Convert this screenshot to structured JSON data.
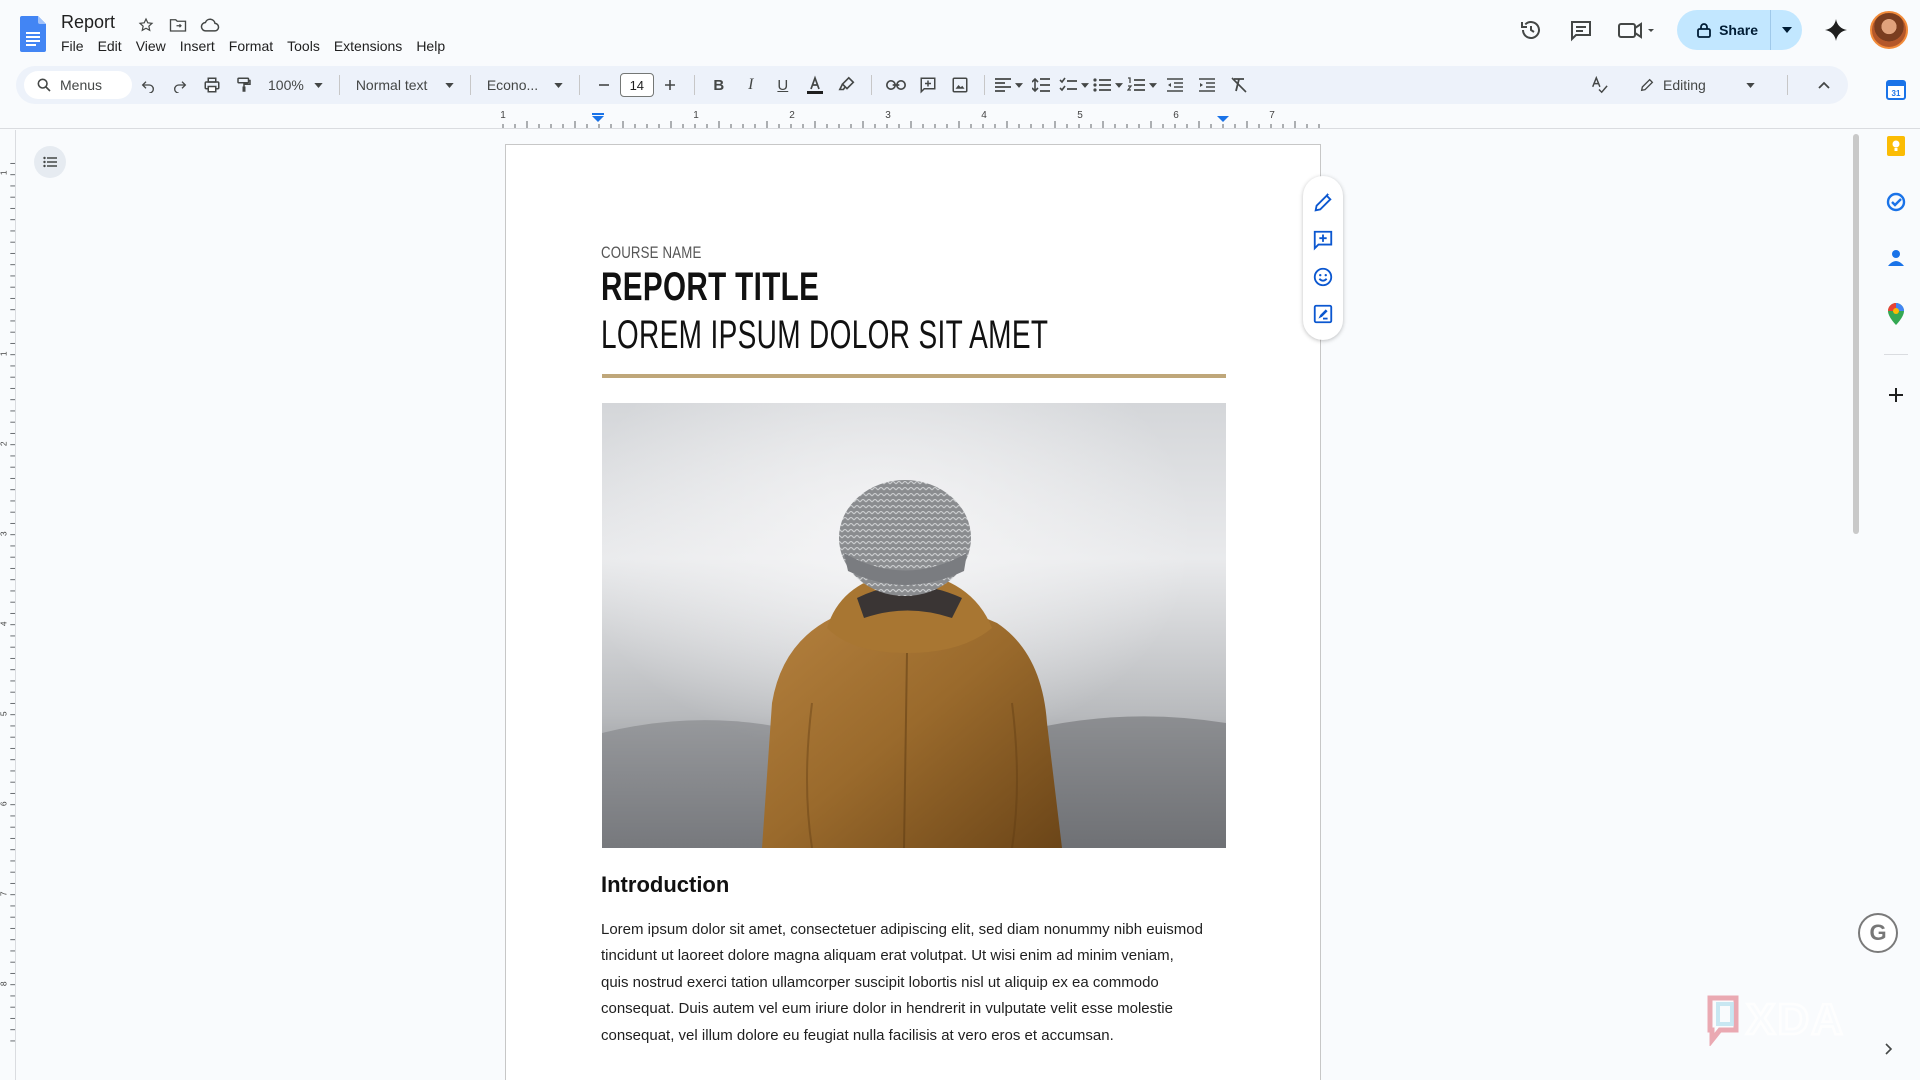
{
  "document": {
    "title": "Report",
    "menus": [
      "File",
      "Edit",
      "View",
      "Insert",
      "Format",
      "Tools",
      "Extensions",
      "Help"
    ]
  },
  "header": {
    "share_label": "Share"
  },
  "toolbar": {
    "menus_label": "Menus",
    "zoom": "100%",
    "style": "Normal text",
    "font": "Econo...",
    "font_size": "14",
    "mode": "Editing"
  },
  "ruler": {
    "labels": [
      "1",
      "1",
      "2",
      "3",
      "4",
      "5",
      "6",
      "7"
    ],
    "vertical_labels": [
      "1",
      "1",
      "2",
      "3",
      "4",
      "5",
      "6",
      "7",
      "8"
    ]
  },
  "page": {
    "course_name": "COURSE NAME",
    "report_title": "REPORT TITLE",
    "subtitle": "LOREM IPSUM DOLOR SIT AMET",
    "intro_heading": "Introduction",
    "body_lines": [
      "Lorem ipsum dolor sit amet, consectetuer adipiscing elit, sed diam nonummy nibh euismod",
      "tincidunt ut laoreet dolore magna aliquam erat volutpat. Ut wisi enim ad minim veniam,",
      "quis nostrud exerci tation ullamcorper suscipit lobortis nisl ut aliquip ex ea commodo",
      "consequat. Duis autem vel eum iriure dolor in hendrerit in vulputate velit esse molestie",
      "consequat, vel illum dolore eu feugiat nulla facilisis at vero eros et accumsan."
    ]
  },
  "watermark": {
    "text": "XDA"
  },
  "colors": {
    "accent": "#0b57d0",
    "share_bg": "#c2e7ff",
    "gold_rule": "#bfa77a",
    "toolbar_bg": "#edf2fa"
  },
  "icons": {
    "title": [
      "star-icon",
      "move-folder-icon",
      "cloud-status-icon"
    ],
    "header": [
      "history-icon",
      "comments-icon",
      "meet-icon",
      "gemini-icon"
    ],
    "side_panel": [
      "calendar-icon",
      "keep-icon",
      "tasks-icon",
      "contacts-icon",
      "maps-icon",
      "add-icon"
    ],
    "float_bar": [
      "edit-suggest-icon",
      "add-comment-icon",
      "emoji-icon",
      "suggest-edits-icon"
    ]
  }
}
